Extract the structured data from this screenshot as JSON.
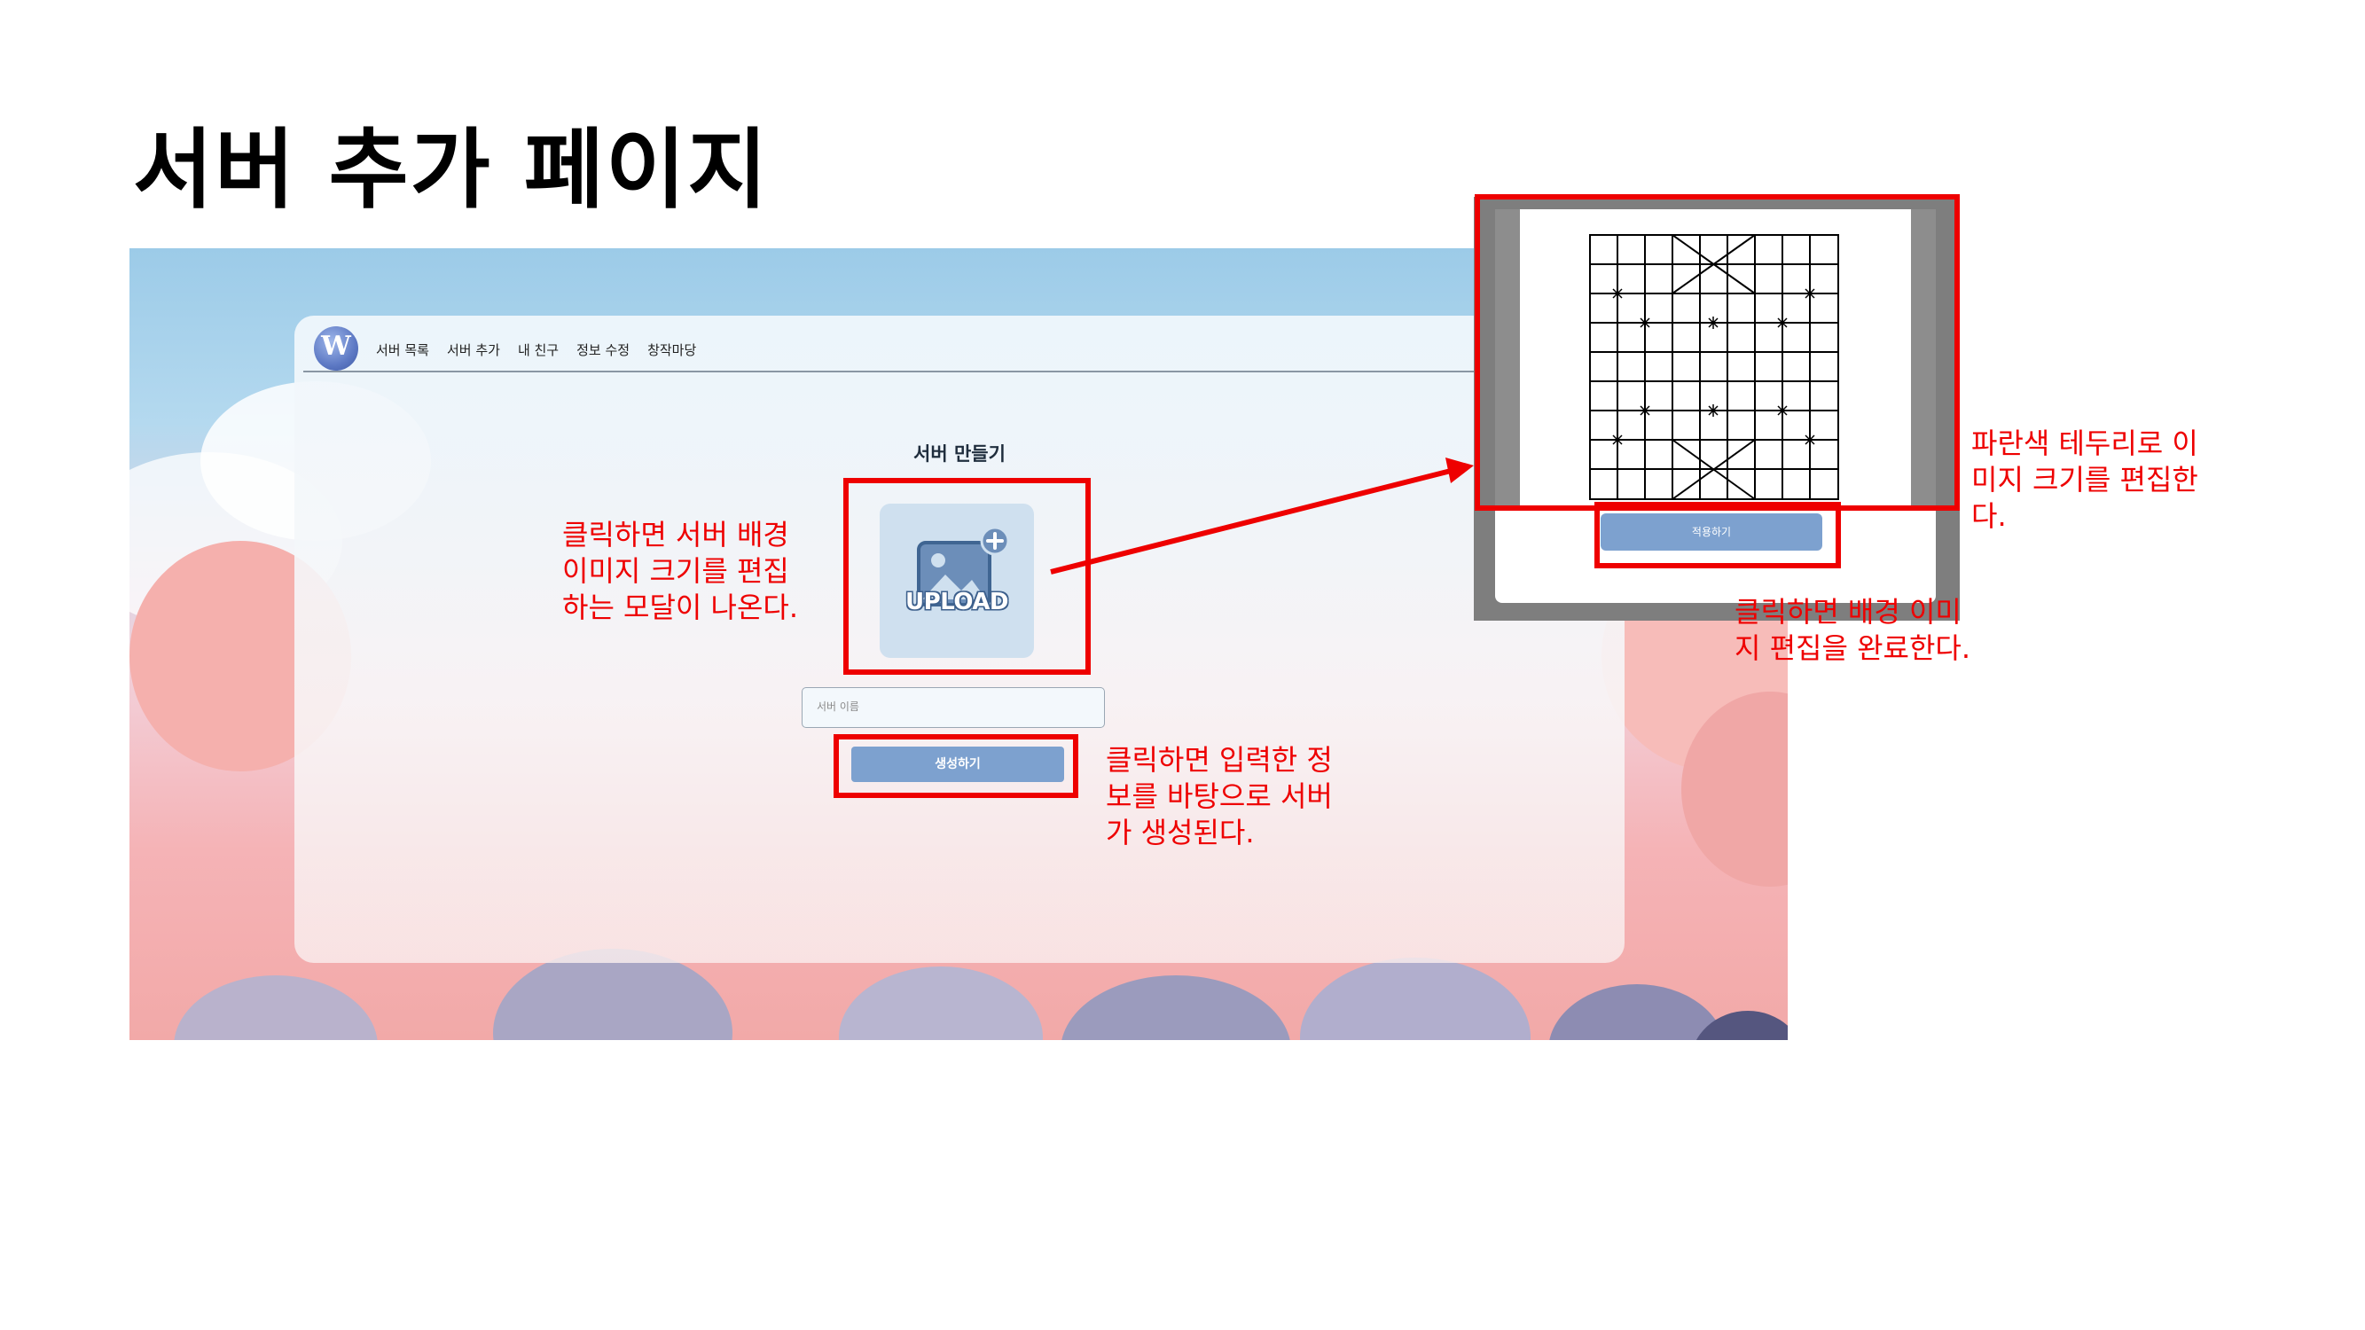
{
  "slide": {
    "title": "서버 추가 페이지"
  },
  "app": {
    "logo_text": "W",
    "nav": [
      "서버 목록",
      "서버 추가",
      "내 친구",
      "정보 수정",
      "창작마당"
    ],
    "form": {
      "title": "서버 만들기",
      "upload_text": "UPLOAD",
      "name_placeholder": "서버 이름",
      "create_button": "생성하기"
    }
  },
  "modal": {
    "apply_button": "적용하기"
  },
  "annotations": {
    "upload": "클릭하면 서버 배경\n이미지 크기를 편집\n하는 모달이 나온다.",
    "create": "클릭하면 입력한 정\n보를 바탕으로 서버\n가 생성된다.",
    "crop": "파란색 테두리로 이\n미지 크기를 편집한\n다.",
    "apply": "클릭하면 배경 이미\n지 편집을 완료한다."
  },
  "colors": {
    "annotation_red": "#ee0000",
    "button_blue": "#7da1cf",
    "upload_bg": "#cfe0ef"
  }
}
